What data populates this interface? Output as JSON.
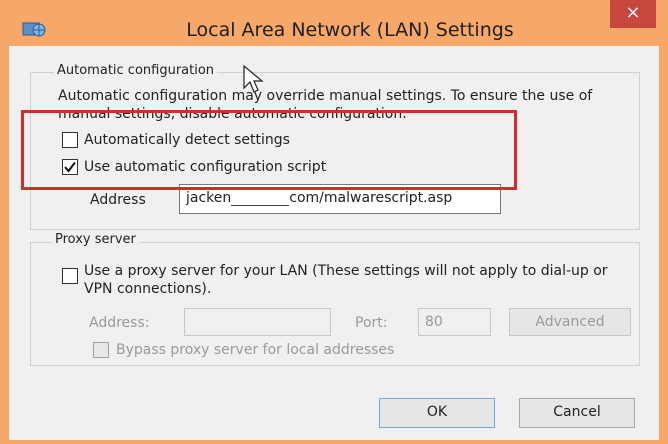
{
  "window": {
    "title": "Local Area Network (LAN) Settings",
    "close_glyph": "×",
    "app_icon": "network-globe-icon",
    "accent_color": "#f5a86a",
    "close_color": "#c8463d"
  },
  "automatic": {
    "group_label": "Automatic configuration",
    "description": "Automatic configuration may override manual settings.  To ensure the use of manual settings, disable automatic configuration.",
    "detect_label": "Automatically detect settings",
    "detect_checked": false,
    "script_label": "Use automatic configuration script",
    "script_checked": true,
    "address_label": "Address",
    "address_prefix": "jacken",
    "address_suffix": "com/malwarescript.asp"
  },
  "proxy": {
    "group_label": "Proxy server",
    "use_proxy_label": "Use a proxy server for your LAN (These settings will not apply to dial-up or VPN connections).",
    "use_proxy_checked": false,
    "address_label": "Address:",
    "address_value": "",
    "port_label": "Port:",
    "port_value": "80",
    "advanced_label": "Advanced",
    "bypass_label": "Bypass proxy server for local addresses",
    "bypass_checked": false
  },
  "buttons": {
    "ok": "OK",
    "cancel": "Cancel"
  },
  "annotation": {
    "highlight_color": "#d62b2b"
  }
}
